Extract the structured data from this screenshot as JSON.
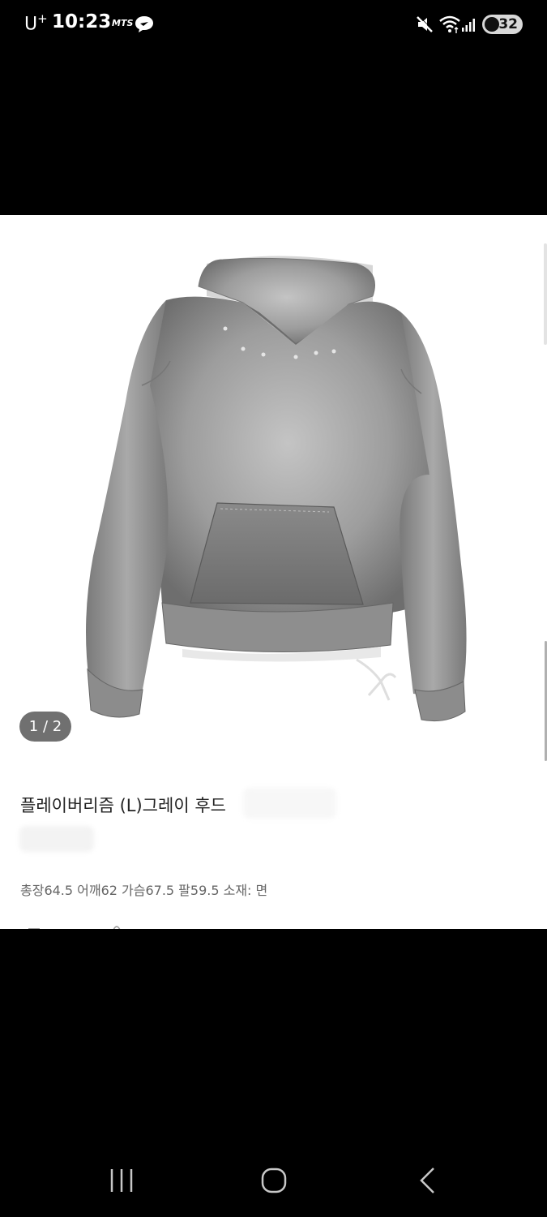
{
  "status_bar": {
    "carrier": "U",
    "carrier_plus": "+",
    "time": "10:23",
    "app_icon_label": "MTS",
    "battery": "32",
    "icons": [
      "mute-icon",
      "wifi-icon",
      "signal-icon",
      "battery-icon"
    ]
  },
  "product": {
    "image_counter": "1 / 2",
    "title": "플레이버리즘 (L)그레이 후드",
    "description": "총장64.5 어깨62 가슴67.5 팔59.5 소재: 면"
  },
  "nav": {
    "icons": [
      "recent-apps-icon",
      "home-icon",
      "back-icon"
    ]
  },
  "colors": {
    "background": "#000000",
    "card": "#ffffff",
    "badge": "#707070",
    "title_text": "#222222",
    "desc_text": "#666666"
  }
}
